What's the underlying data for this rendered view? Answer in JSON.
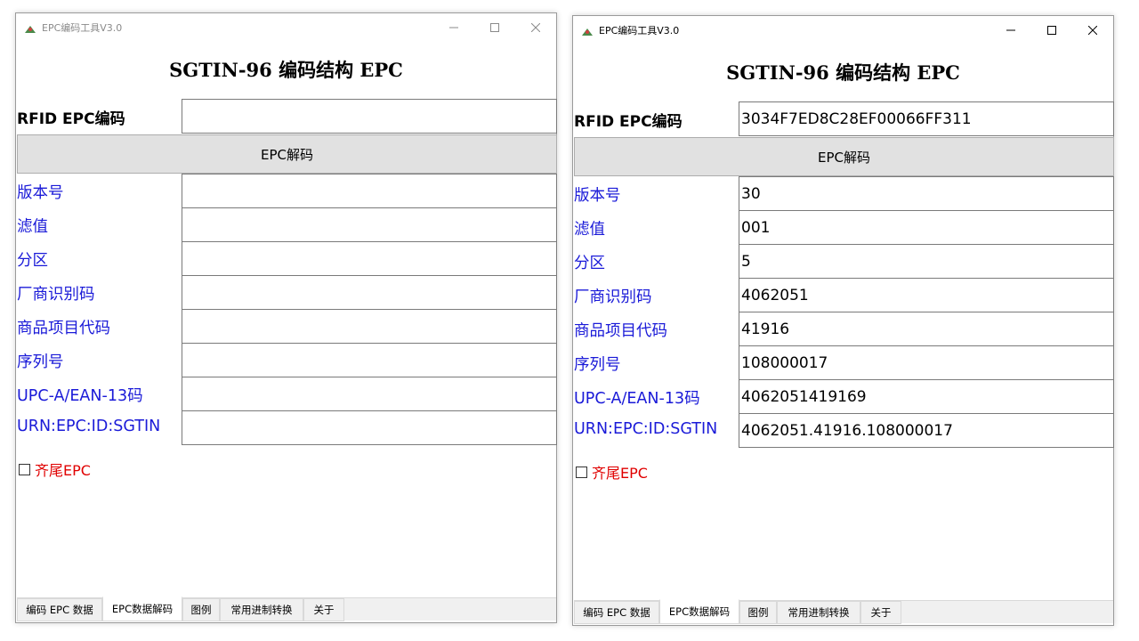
{
  "windows": [
    {
      "title": "EPC编码工具V3.0",
      "heading": "SGTIN-96 编码结构 EPC",
      "rfid_label": "RFID EPC编码",
      "rfid_value": "",
      "decode_button": "EPC解码",
      "rows": [
        {
          "label": "版本号",
          "value": ""
        },
        {
          "label": "滤值",
          "value": ""
        },
        {
          "label": "分区",
          "value": ""
        },
        {
          "label": "厂商识别码",
          "value": ""
        },
        {
          "label": "商品项目代码",
          "value": ""
        },
        {
          "label": "序列号",
          "value": ""
        },
        {
          "label": "UPC-A/EAN-13码",
          "value": ""
        },
        {
          "label": "URN:EPC:ID:SGTIN",
          "value": ""
        }
      ],
      "checkbox_label": "齐尾EPC",
      "checkbox_checked": false,
      "tabs": [
        "编码 EPC 数据",
        "EPC数据解码",
        "图例",
        "常用进制转换",
        "关于"
      ],
      "active_tab": 1,
      "focused": false
    },
    {
      "title": "EPC编码工具V3.0",
      "heading": "SGTIN-96 编码结构 EPC",
      "rfid_label": "RFID EPC编码",
      "rfid_value": "3034F7ED8C28EF00066FF311",
      "decode_button": "EPC解码",
      "rows": [
        {
          "label": "版本号",
          "value": "30"
        },
        {
          "label": "滤值",
          "value": "001"
        },
        {
          "label": "分区",
          "value": "5"
        },
        {
          "label": "厂商识别码",
          "value": "4062051"
        },
        {
          "label": "商品项目代码",
          "value": "41916"
        },
        {
          "label": "序列号",
          "value": "108000017"
        },
        {
          "label": "UPC-A/EAN-13码",
          "value": "4062051419169"
        },
        {
          "label": "URN:EPC:ID:SGTIN",
          "value": "4062051.41916.108000017"
        }
      ],
      "checkbox_label": "齐尾EPC",
      "checkbox_checked": false,
      "tabs": [
        "编码 EPC 数据",
        "EPC数据解码",
        "图例",
        "常用进制转换",
        "关于"
      ],
      "active_tab": 1,
      "focused": true
    }
  ],
  "colors": {
    "label_blue": "#1a1ad8",
    "checkbox_red": "#e00000",
    "button_gray": "#e1e1e1"
  },
  "icons": {
    "app": "app-logo-icon",
    "minimize": "minimize-icon",
    "maximize": "maximize-icon",
    "close": "close-icon"
  }
}
